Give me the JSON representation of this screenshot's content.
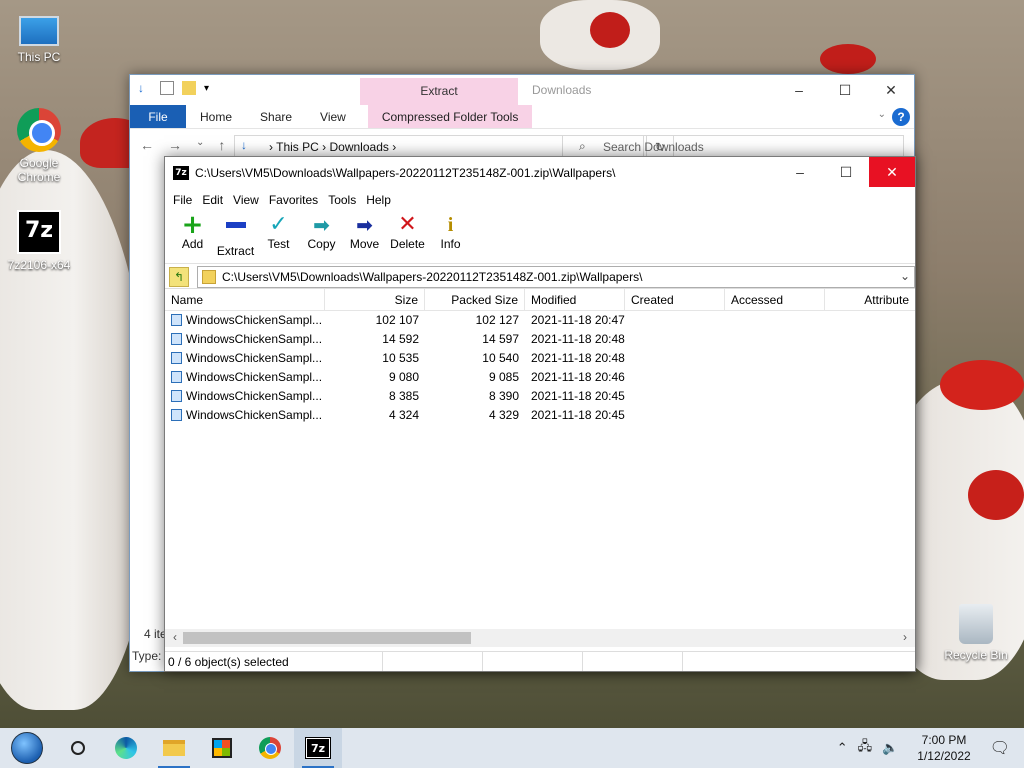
{
  "desktop": {
    "icons": [
      {
        "label": "This PC",
        "icon": "computer-icon"
      },
      {
        "label": "Google Chrome",
        "icon": "chrome-icon"
      },
      {
        "label": "7z2106-x64",
        "icon": "7zip-installer-icon"
      }
    ],
    "recycle_bin": "Recycle Bin"
  },
  "explorer": {
    "title": "Downloads",
    "context_tab": "Extract",
    "tabs": [
      "File",
      "Home",
      "Share",
      "View",
      "Compressed Folder Tools"
    ],
    "breadcrumb": [
      "This PC",
      "Downloads"
    ],
    "search_placeholder": "Search Downloads",
    "status_items": "4 ite",
    "status_type": "Type:"
  },
  "sevenzip": {
    "title": "C:\\Users\\VM5\\Downloads\\Wallpapers-20220112T235148Z-001.zip\\Wallpapers\\",
    "app_icon_text": "7z",
    "menu": [
      "File",
      "Edit",
      "View",
      "Favorites",
      "Tools",
      "Help"
    ],
    "toolbar": [
      {
        "label": "Add",
        "icon": "add-icon"
      },
      {
        "label": "Extract",
        "icon": "extract-icon"
      },
      {
        "label": "Test",
        "icon": "test-icon"
      },
      {
        "label": "Copy",
        "icon": "copy-icon"
      },
      {
        "label": "Move",
        "icon": "move-icon"
      },
      {
        "label": "Delete",
        "icon": "delete-icon"
      },
      {
        "label": "Info",
        "icon": "info-icon"
      }
    ],
    "path": "C:\\Users\\VM5\\Downloads\\Wallpapers-20220112T235148Z-001.zip\\Wallpapers\\",
    "columns": [
      "Name",
      "Size",
      "Packed Size",
      "Modified",
      "Created",
      "Accessed",
      "Attribute"
    ],
    "files": [
      {
        "name": "WindowsChickenSampl...",
        "size": "102 107",
        "packed": "102 127",
        "modified": "2021-11-18 20:47"
      },
      {
        "name": "WindowsChickenSampl...",
        "size": "14 592",
        "packed": "14 597",
        "modified": "2021-11-18 20:48"
      },
      {
        "name": "WindowsChickenSampl...",
        "size": "10 535",
        "packed": "10 540",
        "modified": "2021-11-18 20:48"
      },
      {
        "name": "WindowsChickenSampl...",
        "size": "9 080",
        "packed": "9 085",
        "modified": "2021-11-18 20:46"
      },
      {
        "name": "WindowsChickenSampl...",
        "size": "8 385",
        "packed": "8 390",
        "modified": "2021-11-18 20:45"
      },
      {
        "name": "WindowsChickenSampl...",
        "size": "4 324",
        "packed": "4 329",
        "modified": "2021-11-18 20:45"
      }
    ],
    "status": "0 / 6 object(s) selected"
  },
  "taskbar": {
    "apps": [
      "start-icon",
      "search-icon",
      "edge-icon",
      "file-explorer-icon",
      "store-icon",
      "chrome-icon",
      "7zip-icon"
    ],
    "time": "7:00 PM",
    "date": "1/12/2022"
  }
}
